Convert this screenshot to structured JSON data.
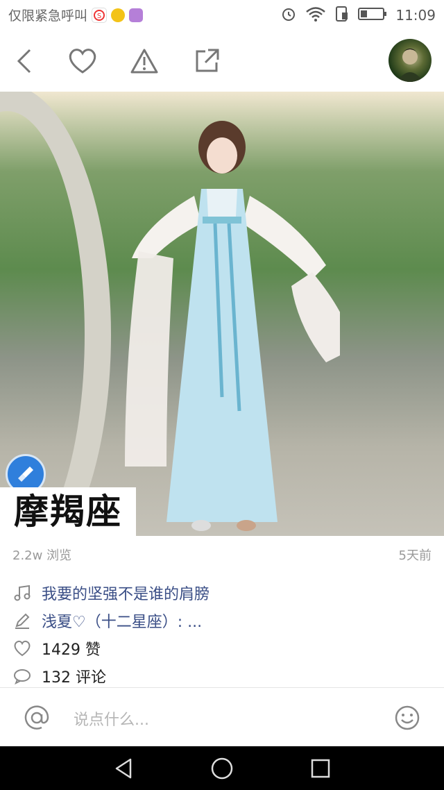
{
  "status_bar": {
    "carrier_text": "仅限紧急呼叫",
    "time": "11:09",
    "app_icons": [
      "weibo-icon",
      "wechat-icon",
      "gallery-icon"
    ],
    "right_icons": [
      "alarm-icon",
      "wifi-icon",
      "sim-icon",
      "battery-icon"
    ]
  },
  "toolbar": {
    "icons": [
      "back-icon",
      "heart-icon",
      "warning-icon",
      "share-icon"
    ],
    "avatar": "user-avatar"
  },
  "post": {
    "image_overlay_text": "摩羯座",
    "views": "2.2w 浏览",
    "posted": "5天前",
    "music_title": "我要的坚强不是谁的肩膀",
    "author_line": "浅夏♡（十二星座）: ...",
    "likes": "1429 赞",
    "comments": "132 评论"
  },
  "comment_bar": {
    "placeholder": "说点什么..."
  },
  "colors": {
    "link": "#3a4e86",
    "accent_blue": "#2f7fdc",
    "nav_bg": "#000000"
  }
}
